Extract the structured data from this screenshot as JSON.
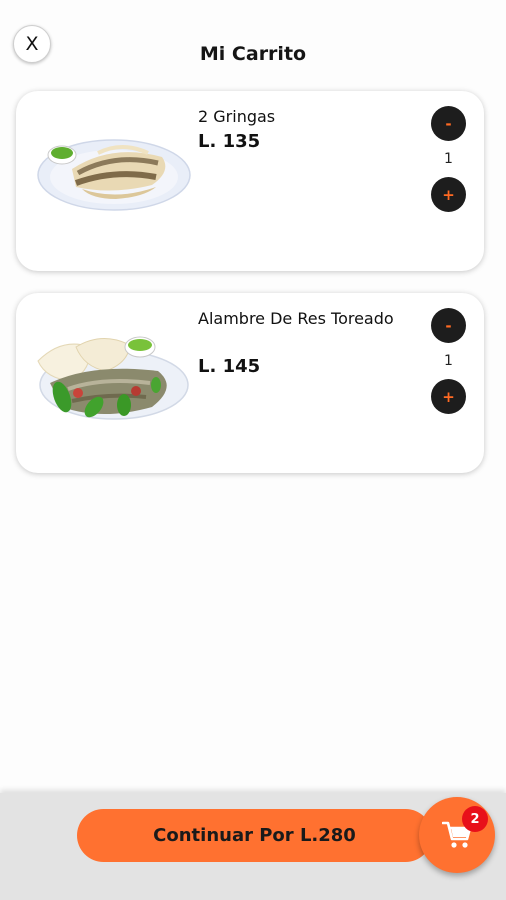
{
  "header": {
    "close_label": "X",
    "title": "Mi Carrito"
  },
  "cart": {
    "items": [
      {
        "name": "2 Gringas",
        "price": "L. 135",
        "quantity": "1",
        "minus_label": "-",
        "plus_label": "+",
        "image_icon": "gringas-tacos-plate"
      },
      {
        "name": "Alambre De Res Toreado",
        "price": "L. 145",
        "quantity": "1",
        "minus_label": "-",
        "plus_label": "+",
        "image_icon": "alambre-de-res-plate"
      }
    ]
  },
  "footer": {
    "continue_label": "Continuar Por L.280",
    "cart_icon": "cart-icon",
    "cart_count": "2"
  },
  "colors": {
    "accent": "#ff7130",
    "button_dark": "#1d1d1d",
    "badge": "#e8101a"
  }
}
